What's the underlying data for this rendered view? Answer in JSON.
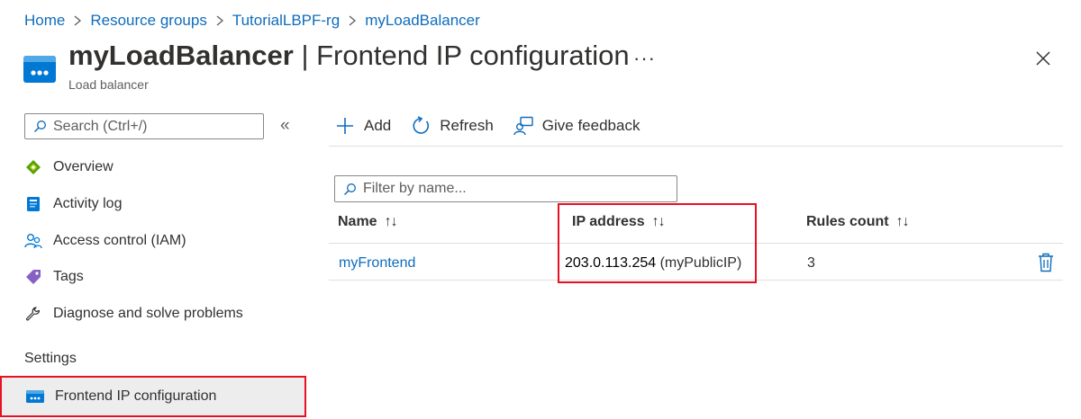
{
  "breadcrumb": {
    "items": [
      "Home",
      "Resource groups",
      "TutorialLBPF-rg",
      "myLoadBalancer"
    ]
  },
  "header": {
    "resource_name": "myLoadBalancer",
    "separator": " | ",
    "page_name": "Frontend IP configuration",
    "subtitle": "Load balancer",
    "more_label": "···"
  },
  "sidebar": {
    "search_placeholder": "Search (Ctrl+/)",
    "collapse_label": "«",
    "items": [
      {
        "label": "Overview",
        "icon": "overview-icon"
      },
      {
        "label": "Activity log",
        "icon": "activity-log-icon"
      },
      {
        "label": "Access control (IAM)",
        "icon": "iam-icon"
      },
      {
        "label": "Tags",
        "icon": "tag-icon"
      },
      {
        "label": "Diagnose and solve problems",
        "icon": "wrench-icon"
      }
    ],
    "section_heading": "Settings",
    "active_item": {
      "label": "Frontend IP configuration",
      "icon": "load-balancer-icon"
    }
  },
  "toolbar": {
    "add_label": "Add",
    "refresh_label": "Refresh",
    "feedback_label": "Give feedback"
  },
  "filter": {
    "placeholder": "Filter by name..."
  },
  "table": {
    "columns": [
      "Name",
      "IP address",
      "Rules count"
    ],
    "sort_glyph": "↑↓",
    "rows": [
      {
        "name": "myFrontend",
        "ip": "203.0.113.254",
        "ip_label": "(myPublicIP)",
        "rules_count": "3"
      }
    ]
  },
  "colors": {
    "accent": "#0f6cbd",
    "highlight": "#e81123",
    "selected_bg": "#ededed"
  }
}
